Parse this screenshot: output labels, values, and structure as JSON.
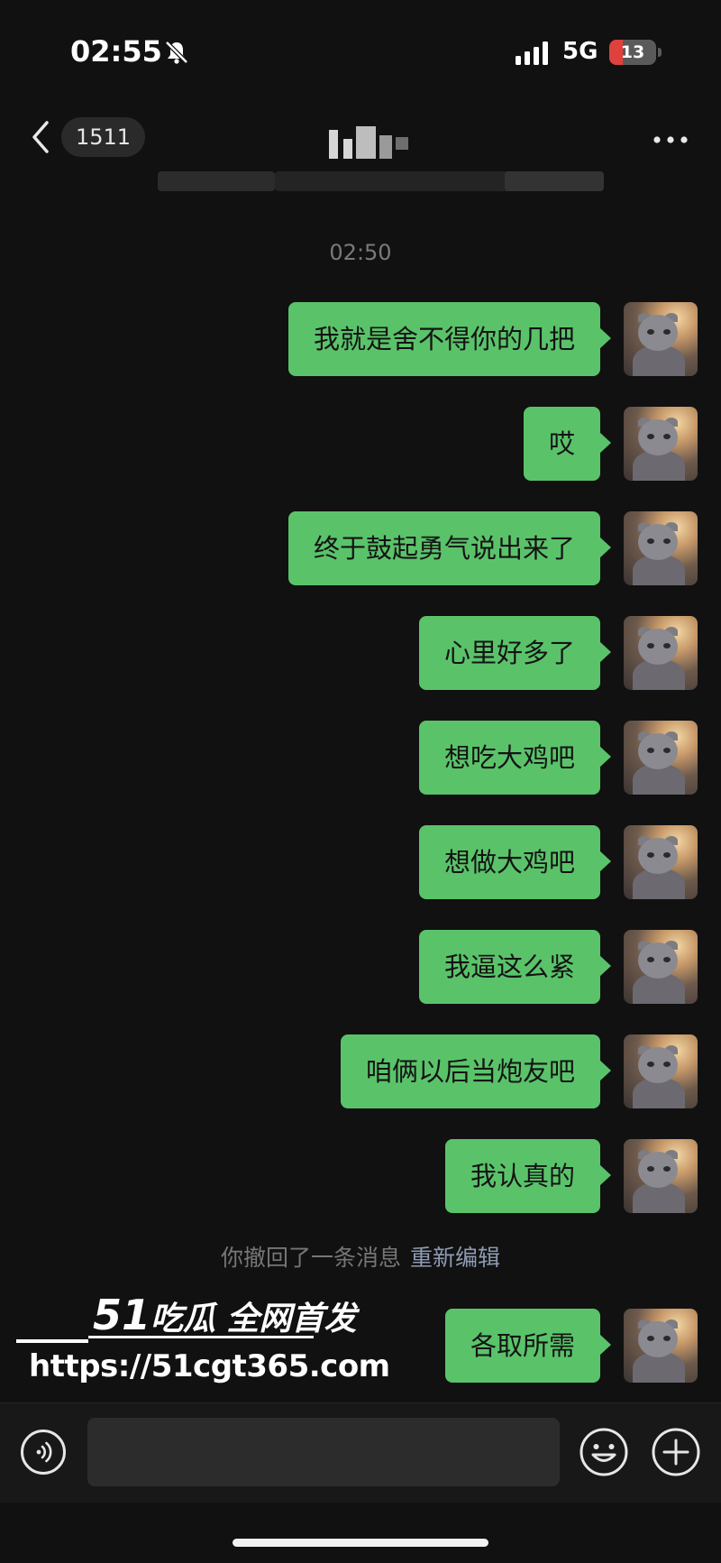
{
  "status_bar": {
    "time": "02:55",
    "network": "5G",
    "battery_level": "13",
    "icons": [
      "bell-mute-icon",
      "signal-icon",
      "battery-icon"
    ],
    "battery_color": "#e0413c"
  },
  "nav": {
    "unread_count": "1511",
    "icons": [
      "back-chevron-icon",
      "more-icon"
    ]
  },
  "chat": {
    "timestamp": "02:50",
    "messages": [
      {
        "text": "我就是舍不得你的几把"
      },
      {
        "text": "哎"
      },
      {
        "text": "终于鼓起勇气说出来了"
      },
      {
        "text": "心里好多了"
      },
      {
        "text": "想吃大鸡吧"
      },
      {
        "text": "想做大鸡吧"
      },
      {
        "text": "我逼这么紧"
      },
      {
        "text": "咱俩以后当炮友吧"
      },
      {
        "text": "我认真的"
      }
    ],
    "recall_notice": {
      "text": "你撤回了一条消息",
      "action": "重新编辑"
    },
    "after_recall": [
      {
        "text": "各取所需"
      }
    ],
    "bubble_color": "#5ac36a"
  },
  "watermark": {
    "num": "51",
    "label": "吃瓜 全网首发",
    "url": "https://51cgt365.com"
  },
  "input_bar": {
    "value": "",
    "icons": [
      "voice-icon",
      "emoji-icon",
      "plus-icon"
    ]
  }
}
